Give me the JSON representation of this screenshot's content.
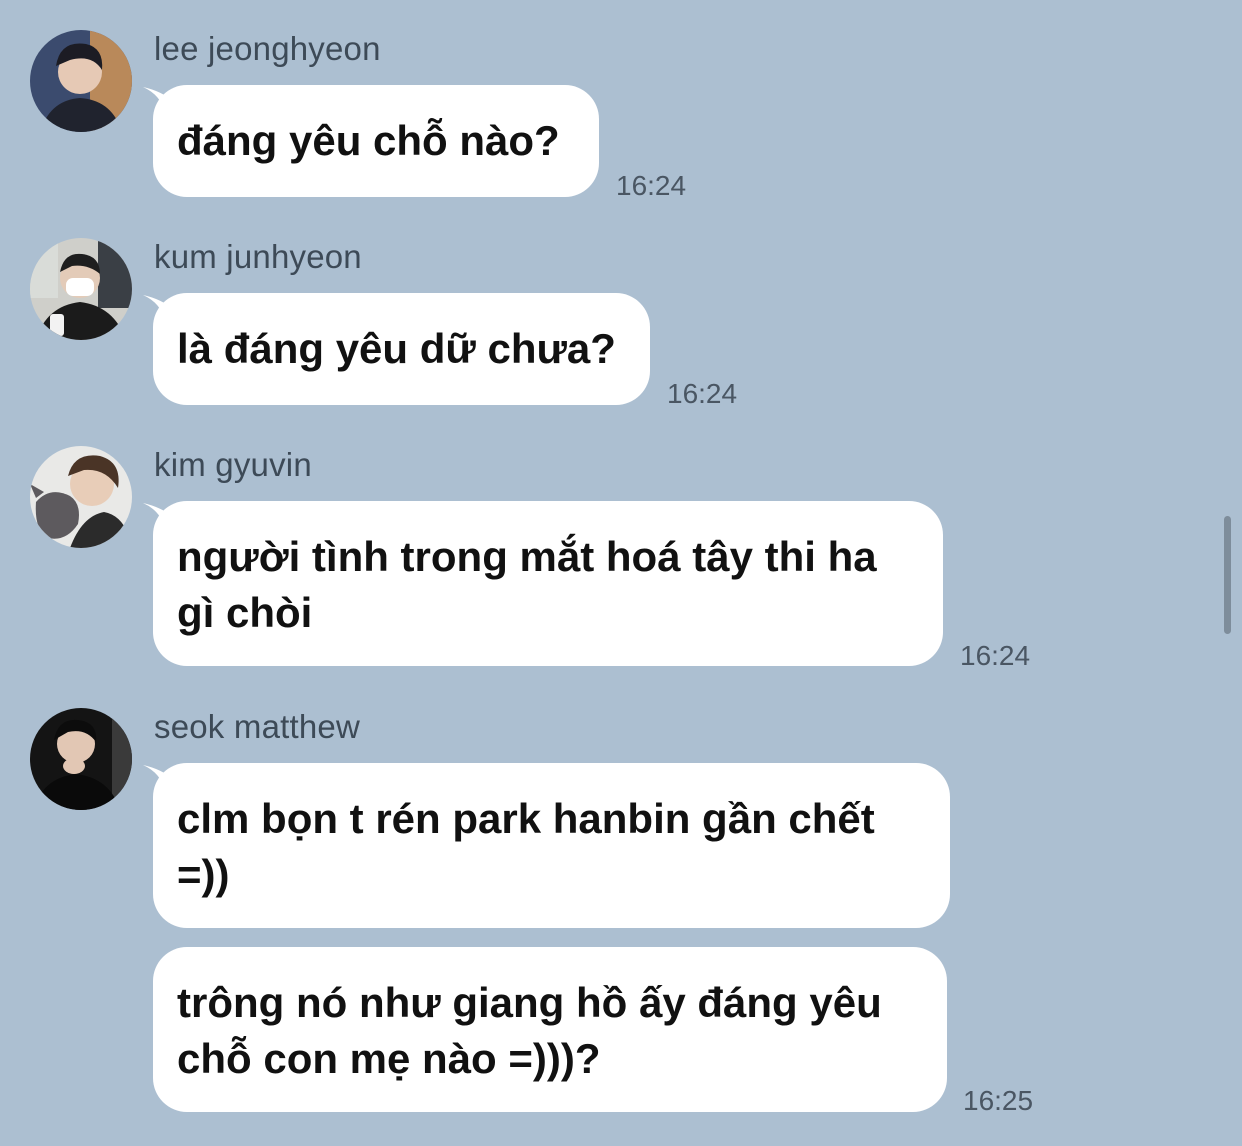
{
  "chat": {
    "messages": [
      {
        "sender": "lee jeonghyeon",
        "avatar_icon": "avatar-photo-icon",
        "bubbles": [
          "đáng yêu chỗ nào?"
        ],
        "time": "16:24"
      },
      {
        "sender": "kum junhyeon",
        "avatar_icon": "avatar-photo-icon",
        "bubbles": [
          "là đáng yêu dữ chưa?"
        ],
        "time": "16:24"
      },
      {
        "sender": "kim gyuvin",
        "avatar_icon": "avatar-photo-icon",
        "bubbles": [
          "người tình trong mắt hoá tây thi ha\ngì chòi"
        ],
        "time": "16:24"
      },
      {
        "sender": "seok matthew",
        "avatar_icon": "avatar-photo-icon",
        "bubbles": [
          "clm bọn t rén park hanbin gần chết\n=))",
          "trông nó như giang hồ ấy đáng yêu\nchỗ con mẹ nào =)))?"
        ],
        "time": "16:25"
      }
    ]
  },
  "colors": {
    "background": "#acbfd1",
    "bubble": "#ffffff",
    "sender_text": "#3d4a57",
    "time_text": "#4a5663"
  }
}
